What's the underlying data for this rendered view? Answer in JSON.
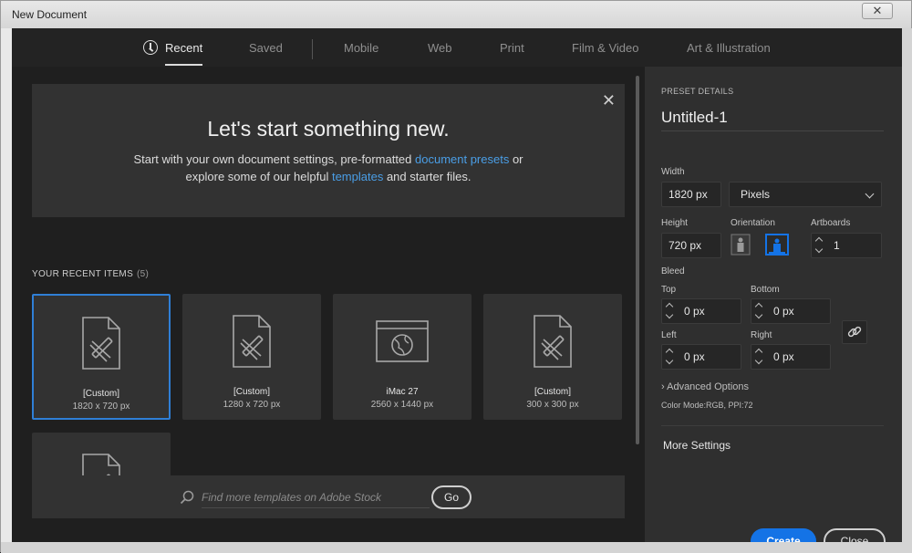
{
  "window": {
    "title": "New Document",
    "close_symbol": "✕"
  },
  "tabs": [
    {
      "label": "Recent",
      "active": true
    },
    {
      "label": "Saved"
    },
    {
      "label": "Mobile"
    },
    {
      "label": "Web"
    },
    {
      "label": "Print"
    },
    {
      "label": "Film & Video"
    },
    {
      "label": "Art & Illustration"
    }
  ],
  "hero": {
    "heading": "Let's start something new.",
    "line1_a": "Start with your own document settings, pre-formatted ",
    "line1_link": "document presets",
    "line1_b": " or",
    "line2_a": "explore some of our helpful ",
    "line2_link": "templates",
    "line2_b": " and starter files.",
    "close_symbol": "✕"
  },
  "recent": {
    "label": "YOUR RECENT ITEMS",
    "count": "(5)",
    "items": [
      {
        "name": "[Custom]",
        "dims": "1820 x 720 px",
        "icon": "custom-doc-icon"
      },
      {
        "name": "[Custom]",
        "dims": "1280 x 720 px",
        "icon": "custom-doc-icon"
      },
      {
        "name": "iMac 27",
        "dims": "2560 x 1440 px",
        "icon": "web-browser-icon"
      },
      {
        "name": "[Custom]",
        "dims": "300 x 300 px",
        "icon": "custom-doc-icon"
      },
      {
        "name": "",
        "dims": "",
        "icon": "custom-doc-icon"
      }
    ]
  },
  "search": {
    "placeholder": "Find more templates on Adobe Stock",
    "go_label": "Go"
  },
  "preset": {
    "section_label": "PRESET DETAILS",
    "name": "Untitled-1",
    "width_label": "Width",
    "width_value": "1820 px",
    "unit_value": "Pixels",
    "height_label": "Height",
    "height_value": "720 px",
    "orientation_label": "Orientation",
    "artboards_label": "Artboards",
    "artboards_value": "1",
    "bleed_label": "Bleed",
    "top_label": "Top",
    "top_value": "0 px",
    "bottom_label": "Bottom",
    "bottom_value": "0 px",
    "left_label": "Left",
    "left_value": "0 px",
    "right_label": "Right",
    "right_value": "0 px",
    "advanced_label": "› Advanced Options",
    "color_mode": "Color Mode:RGB, PPI:72",
    "more_settings": "More Settings"
  },
  "actions": {
    "create_label": "Create",
    "close_label": "Close"
  },
  "colors": {
    "accent": "#1473e6",
    "link": "#4a9ee6",
    "selected_border": "#2f7fd6"
  }
}
